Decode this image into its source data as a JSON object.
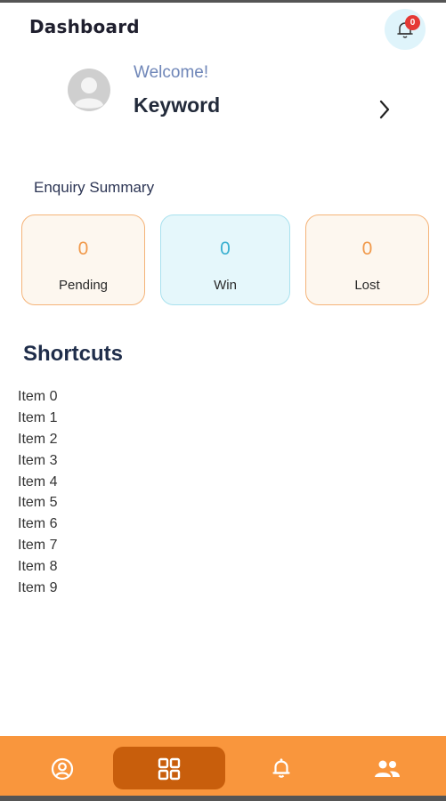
{
  "header": {
    "title": "Dashboard",
    "notification_count": "0"
  },
  "profile": {
    "welcome": "Welcome!",
    "name": "Keyword"
  },
  "enquiry_summary": {
    "title": "Enquiry Summary",
    "cards": [
      {
        "label": "Pending",
        "value": "0",
        "color": "#f19a4c"
      },
      {
        "label": "Win",
        "value": "0",
        "color": "#3ab0d0"
      },
      {
        "label": "Lost",
        "value": "0",
        "color": "#f19a4c"
      }
    ]
  },
  "shortcuts": {
    "title": "Shortcuts",
    "items": [
      "Item 0",
      "Item 1",
      "Item 2",
      "Item 3",
      "Item 4",
      "Item 5",
      "Item 6",
      "Item 7",
      "Item 8",
      "Item 9"
    ]
  },
  "bottom_nav": {
    "items": [
      {
        "icon": "profile-icon",
        "active": false
      },
      {
        "icon": "dashboard-icon",
        "active": true
      },
      {
        "icon": "bell-icon",
        "active": false
      },
      {
        "icon": "team-icon",
        "active": false
      }
    ],
    "accent": "#f9963d",
    "active_color": "#c85e0c"
  }
}
